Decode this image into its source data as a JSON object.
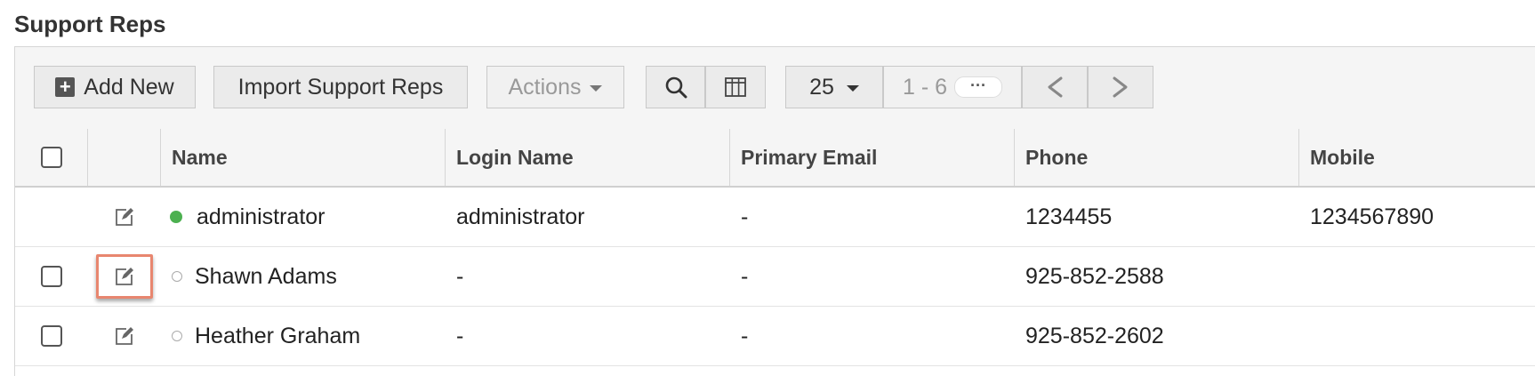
{
  "page": {
    "title": "Support Reps"
  },
  "toolbar": {
    "add_label": "Add New",
    "import_label": "Import Support Reps",
    "actions_label": "Actions",
    "page_size": "25",
    "pager_range": "1 - 6",
    "pager_more": "···",
    "prev_label": "<",
    "next_label": ">"
  },
  "columns": {
    "name": "Name",
    "login": "Login Name",
    "email": "Primary Email",
    "phone": "Phone",
    "mobile": "Mobile"
  },
  "rows": [
    {
      "name": "administrator",
      "login": "administrator",
      "email": "-",
      "phone": "1234455",
      "mobile": "1234567890",
      "status": "online"
    },
    {
      "name": "Shawn Adams",
      "login": "-",
      "email": "-",
      "phone": "925-852-2588",
      "mobile": "",
      "status": "offline"
    },
    {
      "name": "Heather Graham",
      "login": "-",
      "email": "-",
      "phone": "925-852-2602",
      "mobile": "",
      "status": "offline"
    }
  ],
  "colors": {
    "online": "#4cb050",
    "highlight": "#e8866f"
  }
}
